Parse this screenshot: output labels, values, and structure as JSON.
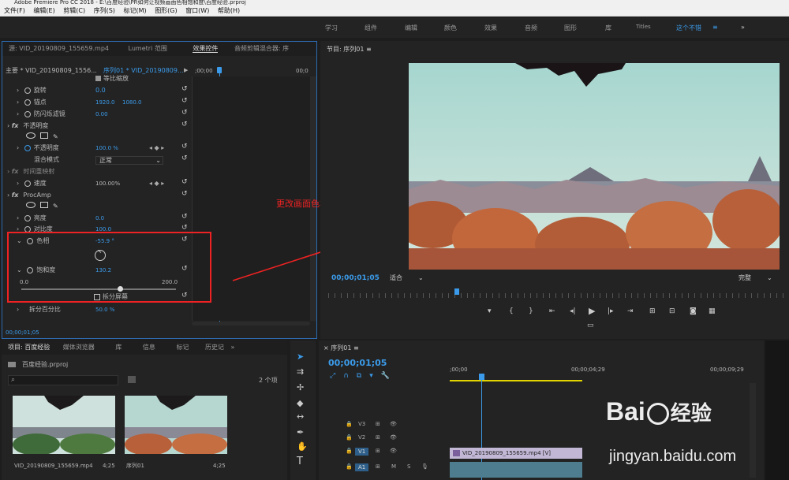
{
  "title": "Adobe Premiere Pro CC 2018 - E:\\百度经验\\PR如何让视频画面色相饱和度\\百度经验.prproj",
  "menu": [
    "文件(F)",
    "编辑(E)",
    "剪辑(C)",
    "序列(S)",
    "标记(M)",
    "图形(G)",
    "窗口(W)",
    "帮助(H)"
  ],
  "workspaces": [
    "学习",
    "组件",
    "编辑",
    "颜色",
    "效果",
    "音频",
    "图形",
    "库",
    "Titles",
    "这个不错"
  ],
  "ws_more": "»",
  "effect_panel": {
    "tabs": [
      "源: VID_20190809_155659.mp4",
      "Lumetri 范围",
      "效果控件",
      "音频剪辑混合器: 序"
    ],
    "master": "主要 * VID_20190809_1556...",
    "seq": "序列01 * VID_20190809...",
    "ruler_start": ";00;00",
    "ruler_end": "00;0",
    "uniform_scale": "等比缩放",
    "rotation_label": "旋转",
    "rotation_value": "0.0",
    "anchor_label": "锚点",
    "anchor_x": "1920.0",
    "anchor_y": "1080.0",
    "flicker_label": "防闪烁滤镜",
    "flicker_value": "0.00",
    "opacity_header": "不透明度",
    "opacity_label": "不透明度",
    "opacity_value": "100.0 %",
    "blend_label": "混合模式",
    "blend_value": "正常",
    "timeremap_header": "时间重映射",
    "speed_label": "速度",
    "speed_value": "100.00%",
    "procamp_header": "ProcAmp",
    "brightness_label": "亮度",
    "brightness_value": "0.0",
    "contrast_label": "对比度",
    "contrast_value": "100.0",
    "hue_label": "色相",
    "hue_value": "-55.9 °",
    "saturation_label": "饱和度",
    "saturation_value": "130.2",
    "sat_min": "0.0",
    "sat_max": "200.0",
    "split_label": "拆分屏幕",
    "split_pct_label": "拆分百分比",
    "split_pct_value": "50.0 %",
    "timecode": "00;00;01;05"
  },
  "annotation": "更改画面色相饱和度",
  "program": {
    "tab": "节目: 序列01",
    "timecode": "00;00;01;05",
    "fit": "适合",
    "quality": "完整"
  },
  "project": {
    "tabs": [
      "项目: 百度经验",
      "媒体浏览器",
      "库",
      "信息",
      "标记",
      "历史记"
    ],
    "folder": "百度经验.prproj",
    "count": "2 个项",
    "item1_name": "VID_20190809_155659.mp4",
    "item1_dur": "4;25",
    "item2_name": "序列01",
    "item2_dur": "4;25"
  },
  "timeline": {
    "tab": "序列01",
    "timecode": "00;00;01;05",
    "mark0": ";00;00",
    "mark1": "00;00;04;29",
    "mark2": "00;00;09;29",
    "tracks": [
      "V3",
      "V2",
      "V1",
      "A1"
    ],
    "clip": "VID_20190809_155659.mp4 [V]"
  },
  "watermark": {
    "brand": "Bai",
    "brand2": "经验",
    "url": "jingyan.baidu.com"
  }
}
